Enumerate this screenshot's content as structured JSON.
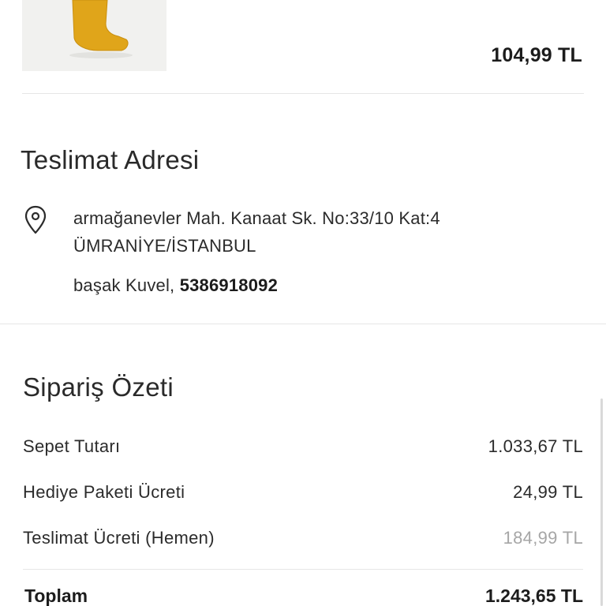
{
  "product": {
    "price": "104,99 TL",
    "image_color": "#E0A51A"
  },
  "delivery": {
    "title": "Teslimat Adresi",
    "icon": "location-pin-icon",
    "address_line1": "armağanevler Mah. Kanaat Sk. No:33/10 Kat:4",
    "address_line2": "ÜMRANİYE/İSTANBUL",
    "recipient_name": "başak Kuvel,",
    "recipient_phone": "5386918092"
  },
  "summary": {
    "title": "Sipariş Özeti",
    "rows": [
      {
        "label": "Sepet Tutarı",
        "value": "1.033,67 TL"
      },
      {
        "label": "Hediye Paketi Ücreti",
        "value": "24,99 TL"
      },
      {
        "label": "Teslimat Ücreti (Hemen)",
        "value": "184,99 TL"
      }
    ],
    "total_label": "Toplam",
    "total_value": "1.243,65 TL"
  }
}
